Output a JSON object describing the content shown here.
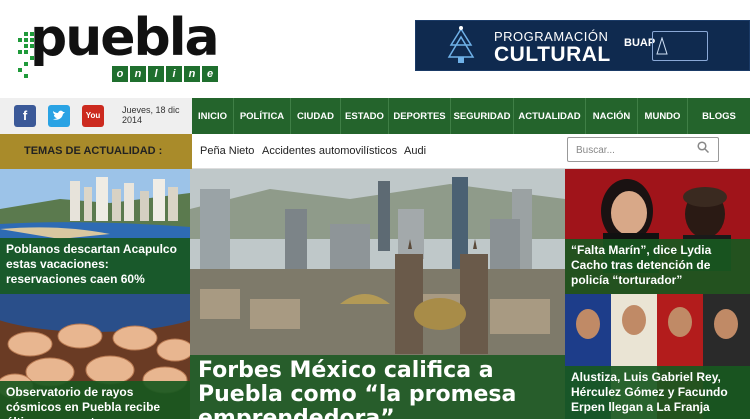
{
  "logo": {
    "word": "puebla",
    "online_letters": [
      "o",
      "n",
      "l",
      "i",
      "n",
      "e"
    ]
  },
  "banner": {
    "line1": "PROGRAMACIÓN",
    "line2": "CULTURAL",
    "org": "BUAP"
  },
  "social": {
    "facebook": "f",
    "twitter": "t",
    "youtube": "You"
  },
  "date": "Jueves, 18 dic 2014",
  "nav": [
    "INICIO",
    "POLÍTICA",
    "CIUDAD",
    "ESTADO",
    "DEPORTES",
    "SEGURIDAD",
    "ACTUALIDAD",
    "NACIÓN",
    "MUNDO",
    "BLOGS"
  ],
  "topics": {
    "label": "TEMAS DE ACTUALIDAD :",
    "items": [
      "Peña Nieto",
      "Accidentes automovilísticos",
      "Audi"
    ]
  },
  "search": {
    "placeholder": "Buscar..."
  },
  "stories": {
    "top_left": "Poblanos descartan Acapulco estas vacaciones: reservaciones caen 60%",
    "bottom_left": "Observatorio de rayos cósmicos en Puebla recibe último segmento",
    "main": "Forbes México califica a Puebla como “la promesa emprendedora”",
    "top_right": "“Falta Marín”, dice Lydia Cacho tras detención de policía “torturador”",
    "bottom_right": "Alustiza, Luis Gabriel Rey, Hérculez Gómez y Facundo Erpen llegan a La Franja"
  },
  "colors": {
    "nav_green": "#24642c",
    "topics_gold": "#a98b2a",
    "banner_navy": "#0f2a4f"
  }
}
